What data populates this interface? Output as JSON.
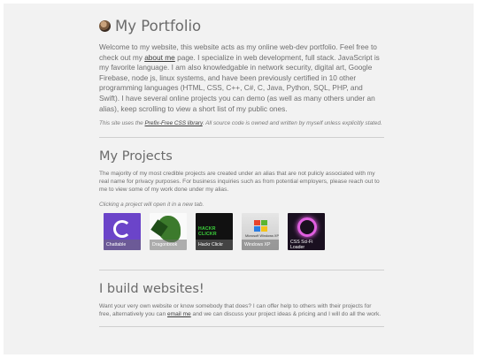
{
  "header": {
    "title": "My Portfolio",
    "intro_before": "Welcome to my website, this website acts as my online web-dev portfolio. Feel free to check out my ",
    "intro_link": "about me",
    "intro_after": " page. I specialize in web development, full stack. JavaScript is my favorite language. I am also knowledgable in network security, digital art, Google Firebase, node js, linux systems, and have been previously certified in 10 other programming languages (HTML, CSS, C++, C#, C, Java, Python, SQL, PHP, and Swift). I have several online projects you can demo (as well as many others under an alias), keep scrolling to view a short list of my public ones.",
    "note_before": "This site uses the ",
    "note_link": "Prefix-Free CSS library",
    "note_after": ". All source code is owned and written by myself unless explicitly stated."
  },
  "projects_section": {
    "title": "My Projects",
    "description": "The majority of my most credible projects are created under an alias that are not pulicly associated with my real name for privacy purposes. For business inquiries such as from potential employers, please reach out to me to view some of my work done under my alias.",
    "hint": "Clicking a project will open it in a new tab.",
    "items": [
      {
        "label": "Chattable",
        "color": "#6b44c9"
      },
      {
        "label": "Dragonbook",
        "color": "#3c7a2c"
      },
      {
        "label": "Hackr Clickr",
        "color": "#111111",
        "logo_text": "HACKR CLICKR"
      },
      {
        "label": "Windows XP",
        "color": "#2b7de1",
        "logo_text": "Microsoft Windows XP"
      },
      {
        "label": "CSS Sci-Fi Loader",
        "color": "#e05fe0"
      }
    ]
  },
  "websites_section": {
    "title": "I build websites!",
    "text_before": "Want your very own website or know somebody that does? I can offer help to others with their projects for free, alternatively you can ",
    "text_link": "email me",
    "text_after": " and we can discuss your project ideas & pricing and I will do all the work."
  }
}
